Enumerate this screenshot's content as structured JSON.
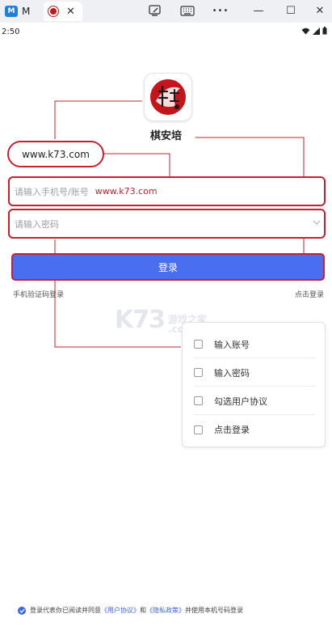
{
  "browser": {
    "tab1_icon_text": "M",
    "tab1_title": "M",
    "tab2_close": "✕",
    "toolbar_more": "•••",
    "minimize": "—",
    "maximize": "☐",
    "close": "✕"
  },
  "status": {
    "time": "2:50"
  },
  "app": {
    "name": "棋安培"
  },
  "callout": {
    "text": "www.k73.com"
  },
  "form": {
    "phone_placeholder": "请输入手机号/账号",
    "phone_typed": "www.k73.com",
    "password_placeholder": "请输入密码",
    "login_label": "登录",
    "sms_login": "手机验证码登录",
    "click_login": "点击登录"
  },
  "watermark": {
    "k73": "K73",
    "cn": "游戏之家",
    "com": ".com"
  },
  "checklist": {
    "items": [
      {
        "label": "输入账号"
      },
      {
        "label": "输入密码"
      },
      {
        "label": "勾选用户协议"
      },
      {
        "label": "点击登录"
      }
    ]
  },
  "agreement": {
    "prefix": "登录代表你已阅读并同意",
    "user_protocol": "《用户协议》",
    "and": "和",
    "privacy_policy": "《隐私政策》",
    "suffix": "并使用本机号码登录"
  },
  "colors": {
    "annotation_red": "#c8202f",
    "login_blue": "#4a6ef0",
    "link_blue": "#3a66e0"
  }
}
